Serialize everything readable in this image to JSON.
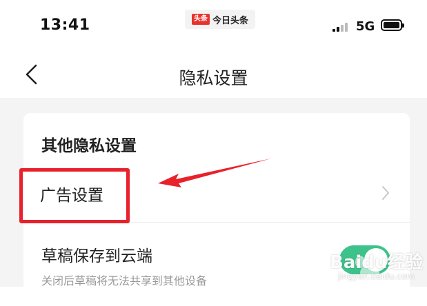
{
  "status_bar": {
    "time": "13:41",
    "app_logo": "头条",
    "app_name": "今日头条",
    "network": "5G"
  },
  "nav": {
    "title": "隐私设置",
    "back_icon": "chevron-left-icon"
  },
  "section": {
    "title": "其他隐私设置",
    "items": [
      {
        "label": "广告设置",
        "icon": "chevron-right-icon"
      },
      {
        "label": "草稿保存到云端",
        "sublabel": "关闭后草稿将无法共享到其他设备",
        "toggle_on": true
      }
    ]
  },
  "annotation": {
    "highlight_color": "#e8212b"
  },
  "watermark": {
    "brand": "Baidu经验",
    "url": "jingyan.baidu.com"
  },
  "colors": {
    "toggle_on": "#3cc28a",
    "background": "#f4f4f4"
  }
}
